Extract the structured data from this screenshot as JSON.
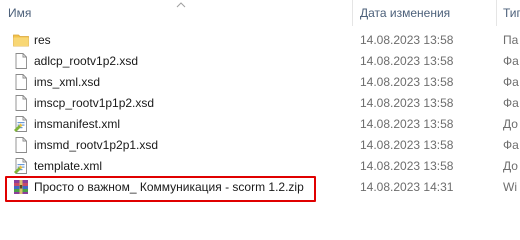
{
  "header": {
    "name": "Имя",
    "date": "Дата изменения",
    "type": "Тип"
  },
  "files": [
    {
      "name": "res",
      "date": "14.08.2023 13:58",
      "type": "Па",
      "icon": "folder-icon"
    },
    {
      "name": "adlcp_rootv1p2.xsd",
      "date": "14.08.2023 13:58",
      "type": "Фа",
      "icon": "file-icon"
    },
    {
      "name": "ims_xml.xsd",
      "date": "14.08.2023 13:58",
      "type": "Фа",
      "icon": "file-icon"
    },
    {
      "name": "imscp_rootv1p1p2.xsd",
      "date": "14.08.2023 13:58",
      "type": "Фа",
      "icon": "file-icon"
    },
    {
      "name": "imsmanifest.xml",
      "date": "14.08.2023 13:58",
      "type": "До",
      "icon": "xml-icon"
    },
    {
      "name": "imsmd_rootv1p2p1.xsd",
      "date": "14.08.2023 13:58",
      "type": "Фа",
      "icon": "file-icon"
    },
    {
      "name": "template.xml",
      "date": "14.08.2023 13:58",
      "type": "До",
      "icon": "xml-icon"
    },
    {
      "name": "Просто о важном_ Коммуникация - scorm 1.2.zip",
      "date": "14.08.2023 14:31",
      "type": "Wi",
      "icon": "zip-archive-icon"
    }
  ],
  "highlight_color": "#e00000"
}
